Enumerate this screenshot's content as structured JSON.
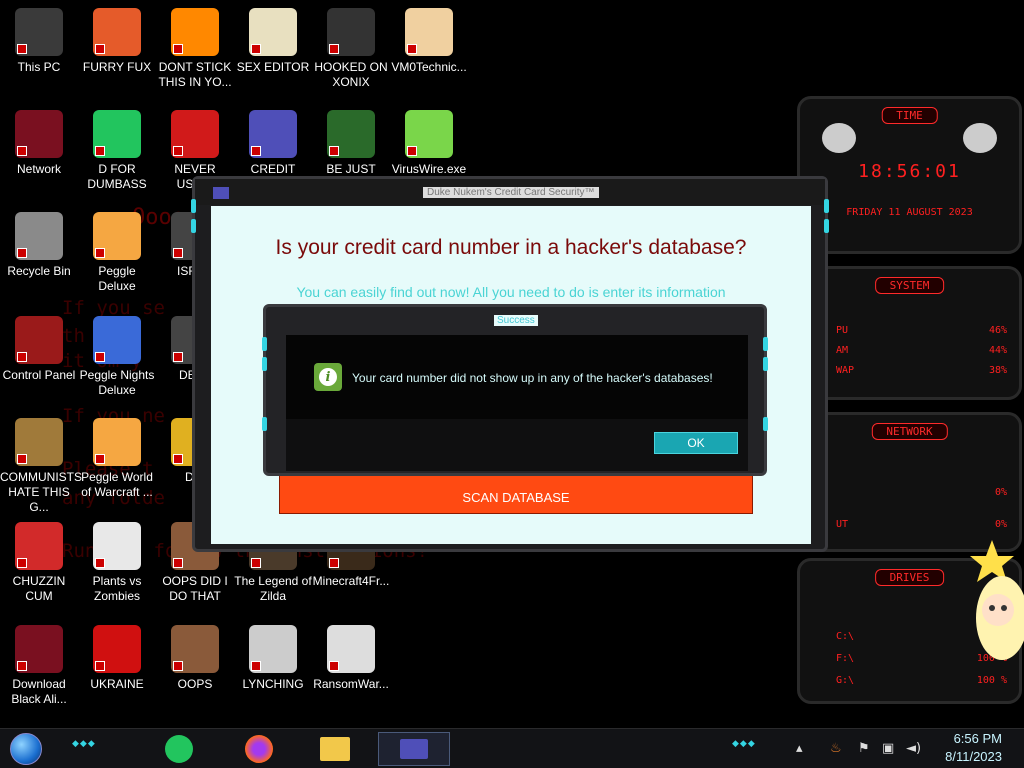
{
  "desktop": {
    "background_text": [
      "If you se",
      "th you",
      "it om y",
      "If you ne",
      "Please t",
      "any folde",
      "Run and follow the instructions!"
    ],
    "background_ooo": "Oooo",
    "icons": [
      {
        "label": "This PC",
        "icon": "pc-icon",
        "color": "#3a3a3a"
      },
      {
        "label": "FURRY FUX",
        "icon": "firefox-icon",
        "color": "#e55b2a"
      },
      {
        "label": "DONT STICK THIS IN YO...",
        "icon": "vlc-cone-icon",
        "color": "#ff8800"
      },
      {
        "label": "SEX EDITOR",
        "icon": "hex-editor-icon",
        "color": "#e8e0c0"
      },
      {
        "label": "HOOKED ON XONIX",
        "icon": "xonix-icon",
        "color": "#333333"
      },
      {
        "label": "VM0Technic...",
        "icon": "doctor-icon",
        "color": "#f0d0a0"
      },
      {
        "label": "Network",
        "icon": "alienware-icon",
        "color": "#7a1020"
      },
      {
        "label": "D FOR DUMBASS",
        "icon": "spotify-icon",
        "color": "#22c55e"
      },
      {
        "label": "NEVER USED!",
        "icon": "dev-cpp-icon",
        "color": "#d11a1a"
      },
      {
        "label": "CREDIT CARD",
        "icon": "credit-card-icon",
        "color": "#4f4fb8"
      },
      {
        "label": "BE JUST LIKE",
        "icon": "elf-icon",
        "color": "#2a6a2a"
      },
      {
        "label": "VirusWire.exe",
        "icon": "lime-icon",
        "color": "#7ad64a"
      },
      {
        "label": "Recycle Bin",
        "icon": "recycle-bin-icon",
        "color": "#8a8a8a"
      },
      {
        "label": "Peggle Deluxe",
        "icon": "peggle-icon",
        "color": "#f5a742"
      },
      {
        "label": "ISRAE",
        "icon": "app-icon",
        "color": "#444444"
      },
      {
        "label": "Control Panel",
        "icon": "control-panel-icon",
        "color": "#9a1a1a"
      },
      {
        "label": "Peggle Nights Deluxe",
        "icon": "peggle-nights-icon",
        "color": "#3a6ad8"
      },
      {
        "label": "DEEZ",
        "icon": "app-icon",
        "color": "#444444"
      },
      {
        "label": "COMMUNISTS HATE THIS G...",
        "icon": "money-bag-icon",
        "color": "#a07a3a"
      },
      {
        "label": "Peggle World of Warcraft ...",
        "icon": "peggle-wow-icon",
        "color": "#f5a742"
      },
      {
        "label": "DIE",
        "icon": "app-icon",
        "color": "#e0b020"
      },
      {
        "label": "CHUZZIN CUM",
        "icon": "chuzzle-icon",
        "color": "#d22a2a"
      },
      {
        "label": "Plants vs Zombies",
        "icon": "flower-icon",
        "color": "#e8e8e8"
      },
      {
        "label": "OOPS DID I DO THAT",
        "icon": "portrait-icon",
        "color": "#8a5a3a"
      },
      {
        "label": "The Legend of Zilda",
        "icon": "zelda-icon",
        "color": "#4a3a2a"
      },
      {
        "label": "Minecraft4Fr...",
        "icon": "minecraft-icon",
        "color": "#3a2a1a"
      },
      {
        "label": "Download Black Ali...",
        "icon": "alienware-icon",
        "color": "#7a1020"
      },
      {
        "label": "UKRAINE",
        "icon": "radiation-icon",
        "color": "#d01010"
      },
      {
        "label": "OOPS",
        "icon": "portrait-icon",
        "color": "#8a5a3a"
      },
      {
        "label": "LYNCHING",
        "icon": "noose-icon",
        "color": "#cccccc"
      },
      {
        "label": "RansomWar...",
        "icon": "skull-icon",
        "color": "#dddddd"
      }
    ]
  },
  "widgets": {
    "time": {
      "title": "TIME",
      "clock": "18:56:01",
      "date": "FRIDAY 11 AUGUST 2023"
    },
    "system": {
      "title": "SYSTEM",
      "rows": [
        {
          "label": "PU",
          "value": "46%"
        },
        {
          "label": "AM",
          "value": "44%"
        },
        {
          "label": "WAP",
          "value": "38%"
        }
      ]
    },
    "network": {
      "title": "NETWORK",
      "rows": [
        {
          "label": "",
          "value": "0%"
        },
        {
          "label": "UT",
          "value": "0%"
        }
      ]
    },
    "drives": {
      "title": "DRIVES",
      "rows": [
        {
          "label": "C:\\",
          "value": ""
        },
        {
          "label": "F:\\",
          "value": "100 %"
        },
        {
          "label": "G:\\",
          "value": "100 %"
        }
      ]
    }
  },
  "main_window": {
    "title": "Duke Nukem's Credit Card Security™",
    "heading": "Is your credit card number in a hacker's database?",
    "subheading": "You can easily find out now! All you need to do is enter its information",
    "scan_button": "SCAN DATABASE"
  },
  "success_dialog": {
    "title": "Success",
    "message": "Your card number did not show up in any of the hacker's databases!",
    "ok_button": "OK",
    "icon": "info-icon"
  },
  "taskbar": {
    "apps": [
      "spotify-icon",
      "firefox-icon",
      "file-explorer-icon",
      "credit-card-icon"
    ],
    "time": "6:56 PM",
    "date": "8/11/2023",
    "tray_icons": [
      "chevron-up-icon",
      "java-icon",
      "flag-icon",
      "network-icon",
      "volume-icon"
    ]
  },
  "colors": {
    "dialog_bg": "#e6fbfa",
    "heading": "#7a0a0a",
    "sub": "#4ad4d4",
    "scan_button": "#ff4a12",
    "ok_button": "#1aa6b2",
    "accent_teal": "#34d5e3",
    "widget_red": "#ff2020"
  }
}
